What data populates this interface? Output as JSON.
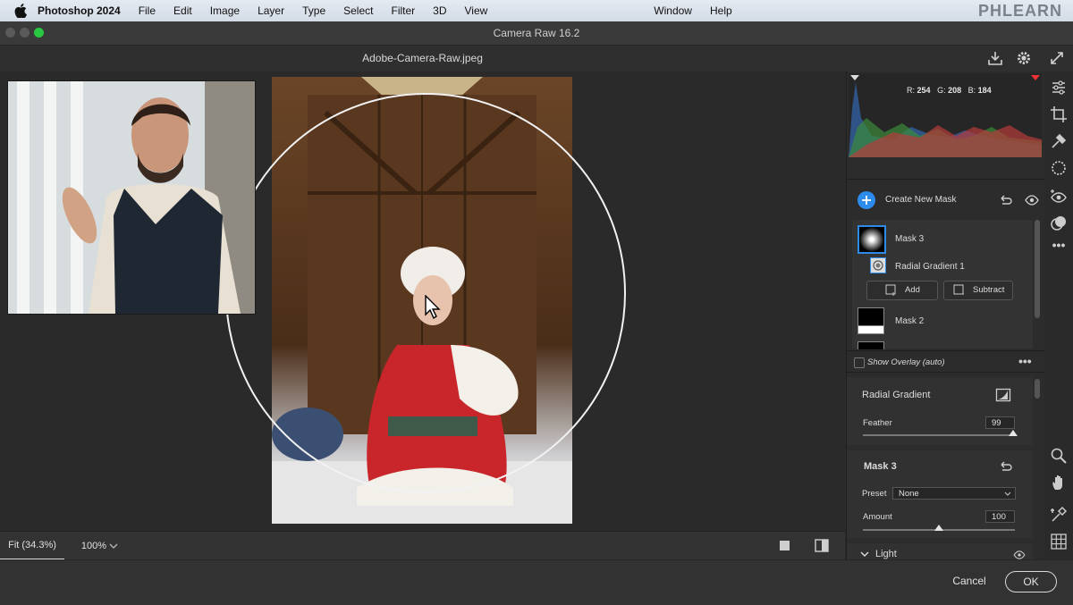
{
  "menubar": {
    "app": "Photoshop 2024",
    "items": [
      "File",
      "Edit",
      "Image",
      "Layer",
      "Type",
      "Select",
      "Filter",
      "3D",
      "View"
    ],
    "right_items": [
      "Window",
      "Help"
    ],
    "brand": "PHLEARN"
  },
  "window": {
    "title": "Camera Raw 16.2",
    "filename": "Adobe-Camera-Raw.jpeg"
  },
  "histogram": {
    "r_label": "R:",
    "r": "254",
    "g_label": "G:",
    "g": "208",
    "b_label": "B:",
    "b": "184"
  },
  "masks": {
    "create_label": "Create New Mask",
    "items": [
      {
        "name": "Mask 3",
        "selected": true
      },
      {
        "name": "Mask 2",
        "selected": false
      }
    ],
    "component": "Radial Gradient 1",
    "add_label": "Add",
    "subtract_label": "Subtract",
    "overlay_label": "Show Overlay (auto)"
  },
  "radial_gradient": {
    "title": "Radial Gradient",
    "feather_label": "Feather",
    "feather_value": "99",
    "feather_level": 0.99
  },
  "mask_settings": {
    "title": "Mask 3",
    "preset_label": "Preset",
    "preset_value": "None",
    "amount_label": "Amount",
    "amount_value": "100",
    "amount_level": 0.5
  },
  "light": {
    "title": "Light"
  },
  "zoom": {
    "fit_label": "Fit (34.3%)",
    "value": "100%"
  },
  "footer": {
    "cancel": "Cancel",
    "ok": "OK"
  },
  "colors": {
    "accent": "#2d8ceb",
    "panel_bg": "#2c2c2c",
    "menubar_bg": "#dbe2eb"
  }
}
